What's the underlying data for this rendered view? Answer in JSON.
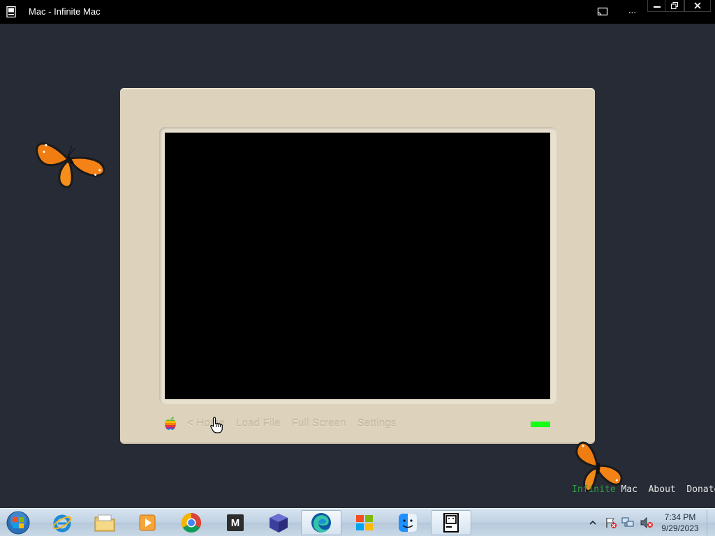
{
  "window": {
    "title": "Mac - Infinite Mac",
    "more_label": "···",
    "icons": [
      "app-icon",
      "cast-icon",
      "more-icon",
      "minimize-icon",
      "restore-icon",
      "close-icon"
    ]
  },
  "emulator": {
    "links": [
      "< Home",
      "Load File",
      "Full Screen",
      "Settings"
    ],
    "led_color": "#13ff13",
    "screen_color": "#000000",
    "bezel_color": "#ddd3bd"
  },
  "footer": {
    "brand_infinite": "Infinite",
    "brand_mac": "Mac",
    "about": "About",
    "donate": "Donate"
  },
  "taskbar": {
    "apps": [
      {
        "name": "internet-explorer"
      },
      {
        "name": "file-explorer"
      },
      {
        "name": "media-player"
      },
      {
        "name": "chrome"
      },
      {
        "name": "m-app",
        "glyph": "M"
      },
      {
        "name": "3d-cube"
      },
      {
        "name": "edge",
        "active": true
      },
      {
        "name": "windows-store"
      },
      {
        "name": "finder"
      },
      {
        "name": "infinite-mac",
        "active": true
      }
    ],
    "time": "7:34 PM",
    "date": "9/29/2023"
  }
}
